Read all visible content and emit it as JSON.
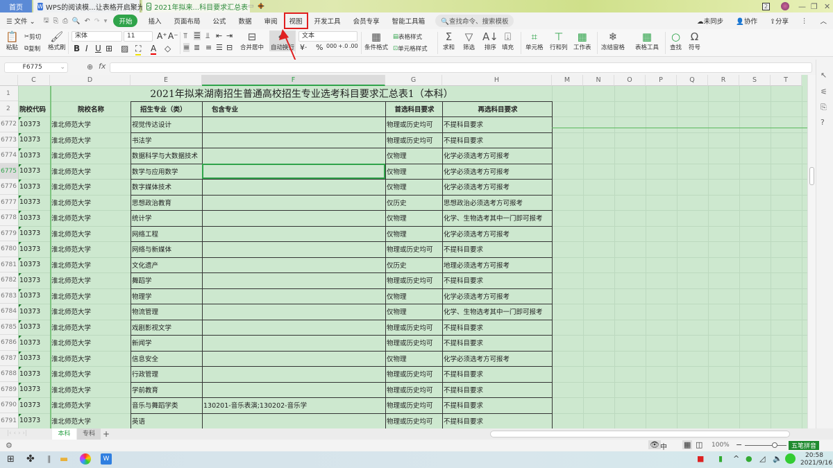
{
  "titlebar": {
    "home_tab": "首页",
    "doc_tabs": [
      {
        "label": "WPS的阅读模...让表格开启聚光灯",
        "icon": "W"
      },
      {
        "label": "2021年拟来...科目要求汇总表",
        "icon": "S"
      }
    ],
    "new_tab": "+",
    "badge": "2"
  },
  "menubar": {
    "file": "文件",
    "items": [
      "开始",
      "插入",
      "页面布局",
      "公式",
      "数据",
      "审阅",
      "视图",
      "开发工具",
      "会员专享",
      "智能工具箱"
    ],
    "search": "查找命令、搜索模板",
    "right": [
      "未同步",
      "协作",
      "分享"
    ]
  },
  "ribbon": {
    "paste": "粘贴",
    "cut": "剪切",
    "copy": "复制",
    "format_painter": "格式刷",
    "font_name": "宋体",
    "font_size": "11",
    "merge": "合并居中",
    "wrap": "自动换行",
    "number_format": "文本",
    "cond_format": "条件格式",
    "table_style": "表格样式",
    "cell_style": "单元格样式",
    "sum": "求和",
    "filter": "筛选",
    "sort": "排序",
    "fill": "填充",
    "cell": "单元格",
    "rowcol": "行和列",
    "worksheet": "工作表",
    "freeze": "冻结窗格",
    "table_tools": "表格工具",
    "find": "查找",
    "symbol": "符号"
  },
  "formula_bar": {
    "name_box": "F6775",
    "fx": "fx",
    "value": ""
  },
  "sheet": {
    "columns": [
      "C",
      "D",
      "E",
      "F",
      "G",
      "H",
      "M",
      "N",
      "O",
      "P",
      "Q",
      "R",
      "S",
      "T"
    ],
    "title": "2021年拟来湖南招生普通高校招生专业选考科目要求汇总表1（本科）",
    "headers": [
      "院校代码",
      "院校名称",
      "招生专业（类）",
      "包含专业",
      "首选科目要求",
      "再选科目要求"
    ],
    "rows": [
      {
        "n": "6772",
        "code": "10373",
        "school": "淮北师范大学",
        "major": "视觉传达设计",
        "incl": "",
        "first": "物理或历史均可",
        "second": "不提科目要求"
      },
      {
        "n": "6773",
        "code": "10373",
        "school": "淮北师范大学",
        "major": "书法学",
        "incl": "",
        "first": "物理或历史均可",
        "second": "不提科目要求"
      },
      {
        "n": "6774",
        "code": "10373",
        "school": "淮北师范大学",
        "major": "数据科学与大数据技术",
        "incl": "",
        "first": "仅物理",
        "second": "化学必须选考方可报考"
      },
      {
        "n": "6775",
        "code": "10373",
        "school": "淮北师范大学",
        "major": "数学与应用数学",
        "incl": "",
        "first": "仅物理",
        "second": "化学必须选考方可报考"
      },
      {
        "n": "6776",
        "code": "10373",
        "school": "淮北师范大学",
        "major": "数字媒体技术",
        "incl": "",
        "first": "仅物理",
        "second": "化学必须选考方可报考"
      },
      {
        "n": "6777",
        "code": "10373",
        "school": "淮北师范大学",
        "major": "思想政治教育",
        "incl": "",
        "first": "仅历史",
        "second": "思想政治必须选考方可报考"
      },
      {
        "n": "6778",
        "code": "10373",
        "school": "淮北师范大学",
        "major": "统计学",
        "incl": "",
        "first": "仅物理",
        "second": "化学、生物选考其中一门即可报考"
      },
      {
        "n": "6779",
        "code": "10373",
        "school": "淮北师范大学",
        "major": "网络工程",
        "incl": "",
        "first": "仅物理",
        "second": "化学必须选考方可报考"
      },
      {
        "n": "6780",
        "code": "10373",
        "school": "淮北师范大学",
        "major": "网络与新媒体",
        "incl": "",
        "first": "物理或历史均可",
        "second": "不提科目要求"
      },
      {
        "n": "6781",
        "code": "10373",
        "school": "淮北师范大学",
        "major": "文化遗产",
        "incl": "",
        "first": "仅历史",
        "second": "地理必须选考方可报考"
      },
      {
        "n": "6782",
        "code": "10373",
        "school": "淮北师范大学",
        "major": "舞蹈学",
        "incl": "",
        "first": "物理或历史均可",
        "second": "不提科目要求"
      },
      {
        "n": "6783",
        "code": "10373",
        "school": "淮北师范大学",
        "major": "物理学",
        "incl": "",
        "first": "仅物理",
        "second": "化学必须选考方可报考"
      },
      {
        "n": "6784",
        "code": "10373",
        "school": "淮北师范大学",
        "major": "物流管理",
        "incl": "",
        "first": "仅物理",
        "second": "化学、生物选考其中一门即可报考"
      },
      {
        "n": "6785",
        "code": "10373",
        "school": "淮北师范大学",
        "major": "戏剧影视文学",
        "incl": "",
        "first": "物理或历史均可",
        "second": "不提科目要求"
      },
      {
        "n": "6786",
        "code": "10373",
        "school": "淮北师范大学",
        "major": "新闻学",
        "incl": "",
        "first": "物理或历史均可",
        "second": "不提科目要求"
      },
      {
        "n": "6787",
        "code": "10373",
        "school": "淮北师范大学",
        "major": "信息安全",
        "incl": "",
        "first": "仅物理",
        "second": "化学必须选考方可报考"
      },
      {
        "n": "6788",
        "code": "10373",
        "school": "淮北师范大学",
        "major": "行政管理",
        "incl": "",
        "first": "物理或历史均可",
        "second": "不提科目要求"
      },
      {
        "n": "6789",
        "code": "10373",
        "school": "淮北师范大学",
        "major": "学前教育",
        "incl": "",
        "first": "物理或历史均可",
        "second": "不提科目要求"
      },
      {
        "n": "6790",
        "code": "10373",
        "school": "淮北师范大学",
        "major": "音乐与舞蹈学类",
        "incl": "130201-音乐表演;130202-音乐学",
        "first": "物理或历史均可",
        "second": "不提科目要求"
      },
      {
        "n": "6791",
        "code": "10373",
        "school": "淮北师范大学",
        "major": "英语",
        "incl": "",
        "first": "物理或历史均可",
        "second": "不提科目要求"
      }
    ]
  },
  "sheet_tabs": {
    "tabs": [
      "本科",
      "专科"
    ],
    "active": "本科",
    "add": "+"
  },
  "statusbar": {
    "zoom": "100%",
    "ime": "五笔拼音",
    "lang": "中"
  },
  "taskbar": {
    "time": "20:58",
    "date": "2021/9/16"
  },
  "colors": {
    "accent": "#2fa34a",
    "cell_fill": "#cde8cf",
    "highlight": "#e02020"
  }
}
